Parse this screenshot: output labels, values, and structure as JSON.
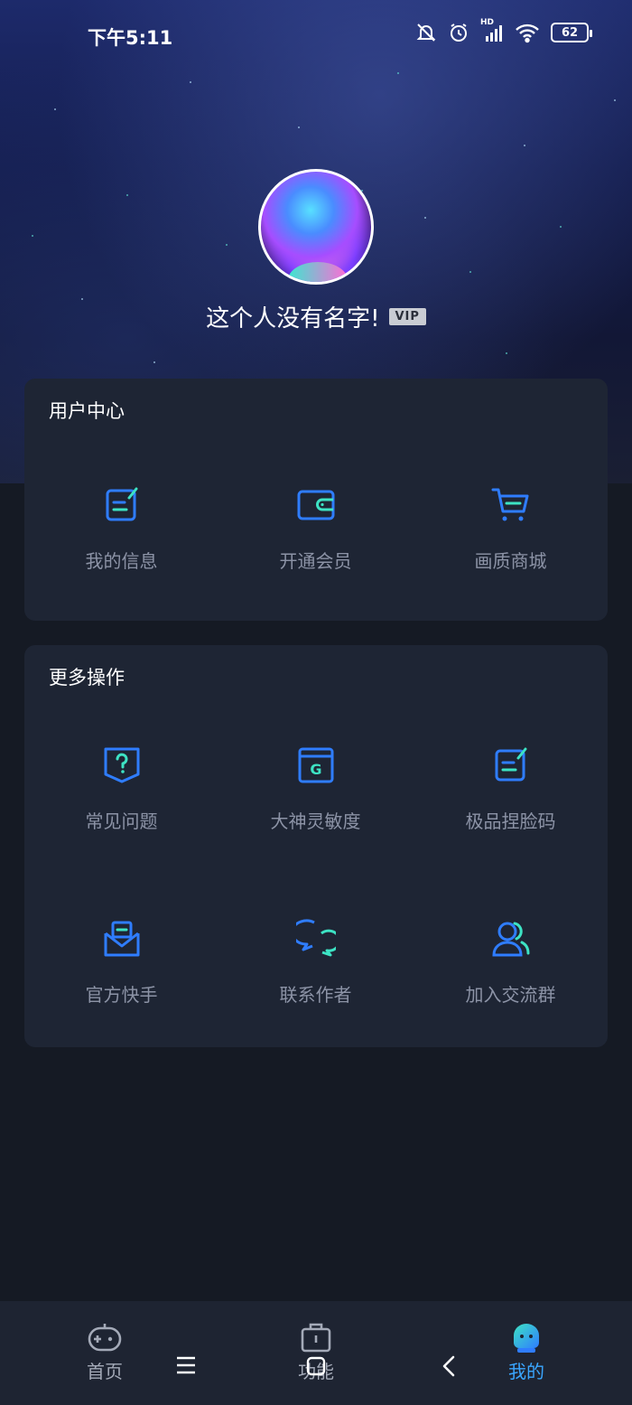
{
  "status_bar": {
    "time": "下午5:11",
    "network_label": "HD",
    "battery": "62"
  },
  "profile": {
    "name": "这个人没有名字!",
    "badge": "VIP"
  },
  "user_center": {
    "title": "用户中心",
    "items": [
      {
        "label": "我的信息",
        "icon": "edit-note-icon"
      },
      {
        "label": "开通会员",
        "icon": "wallet-icon"
      },
      {
        "label": "画质商城",
        "icon": "cart-icon"
      }
    ]
  },
  "more_actions": {
    "title": "更多操作",
    "items": [
      {
        "label": "常见问题",
        "icon": "question-shield-icon"
      },
      {
        "label": "大神灵敏度",
        "icon": "g-window-icon"
      },
      {
        "label": "极品捏脸码",
        "icon": "edit-note-icon"
      },
      {
        "label": "官方快手",
        "icon": "mail-icon"
      },
      {
        "label": "联系作者",
        "icon": "chat-bubbles-icon"
      },
      {
        "label": "加入交流群",
        "icon": "group-users-icon"
      }
    ]
  },
  "bottom_nav": {
    "items": [
      {
        "label": "首页",
        "icon": "gamepad-icon"
      },
      {
        "label": "功能",
        "icon": "toolbox-icon"
      },
      {
        "label": "我的",
        "icon": "mascot-icon",
        "active": true
      }
    ]
  },
  "colors": {
    "accent_blue": "#2f7dff",
    "accent_teal": "#3de3c4",
    "active_nav": "#3aa6ff",
    "card_bg": "#1e2534"
  }
}
